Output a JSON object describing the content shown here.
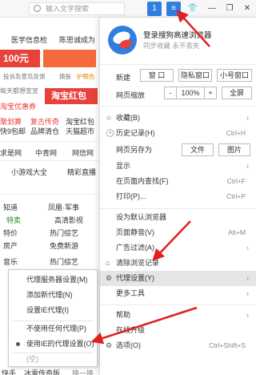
{
  "browser": {
    "search_placeholder": "输入文字搜索",
    "window_buttons": [
      "1",
      "≡",
      "👕",
      "—",
      "❐",
      "✕"
    ]
  },
  "background": {
    "lines": [
      "医学信息检",
      "陈思诚成为",
      "100元",
      "投诉及意见反馈",
      "换肤",
      "护眼色",
      "每天都想宣宣",
      "淘宝红包",
      "淘宝优惠券",
      "聚划算",
      "复古传奇",
      "淘宝红包",
      "快9包邮",
      "品牌清仓",
      "天猫超市",
      "求是网",
      "中青网",
      "网信网",
      "小游戏大全",
      "精彩直播",
      "知道",
      "凤凰·军事",
      "特卖",
      "高清影视",
      "特价",
      "热门综艺",
      "房产",
      "免费新游",
      "音乐",
      "热门综艺",
      "快手",
      "冰雪传奇版",
      "换一换"
    ]
  },
  "menu": {
    "login_title": "登录搜狗高速浏览器",
    "login_sub": "同步收藏 永不丢失",
    "new_label": "新建",
    "new_buttons": [
      "窗 口",
      "隐私窗口",
      "小号窗口"
    ],
    "zoom_label": "网页缩放",
    "zoom_minus": "-",
    "zoom_value": "100%",
    "zoom_plus": "+",
    "fullscreen": "全屏",
    "items": [
      {
        "icon": "☆",
        "label": "收藏(B)",
        "shortcut": "",
        "arrow": "›"
      },
      {
        "icon": "🕒",
        "label": "历史记录(H)",
        "shortcut": "Ctrl+H",
        "arrow": ""
      },
      {
        "icon": "",
        "label": "网页另存为",
        "shortcut": "",
        "arrow": ""
      },
      {
        "icon": "",
        "label": "显示",
        "shortcut": "",
        "arrow": "›"
      },
      {
        "icon": "",
        "label": "在页面内查找(F)",
        "shortcut": "Ctrl+F",
        "arrow": ""
      },
      {
        "icon": "",
        "label": "打印(P)...",
        "shortcut": "Ctrl+P",
        "arrow": ""
      },
      {
        "icon": "",
        "label": "设为默认浏览器",
        "shortcut": "",
        "arrow": ""
      },
      {
        "icon": "",
        "label": "页面静音(V)",
        "shortcut": "Alt+M",
        "arrow": ""
      },
      {
        "icon": "",
        "label": "广告过滤(A)",
        "shortcut": "",
        "arrow": "›"
      },
      {
        "icon": "⌂",
        "label": "清除浏览记录",
        "shortcut": "",
        "arrow": ""
      },
      {
        "icon": "⚙",
        "label": "代理设置(Y)",
        "shortcut": "",
        "arrow": "›"
      },
      {
        "icon": "",
        "label": "更多工具",
        "shortcut": "",
        "arrow": "›"
      },
      {
        "icon": "",
        "label": "帮助",
        "shortcut": "",
        "arrow": "›"
      },
      {
        "icon": "",
        "label": "在线升级",
        "shortcut": "",
        "arrow": ""
      },
      {
        "icon": "⚙",
        "label": "选项(O)",
        "shortcut": "Ctrl+Shift+S",
        "arrow": ""
      }
    ],
    "save_as_buttons": [
      "文件",
      "图片"
    ]
  },
  "submenu": {
    "items": [
      {
        "label": "代理服务器设置(M)"
      },
      {
        "label": "添加新代理(N)"
      },
      {
        "label": "设置IE代理(I)"
      },
      {
        "label": "不使用任何代理(P)"
      },
      {
        "label": "使用IE的代理设置(O)"
      },
      {
        "label": "(空)"
      }
    ]
  },
  "colors": {
    "accent": "#2f7ee0",
    "arrow_red": "#e02020",
    "highlight": "#e5e5e5"
  }
}
